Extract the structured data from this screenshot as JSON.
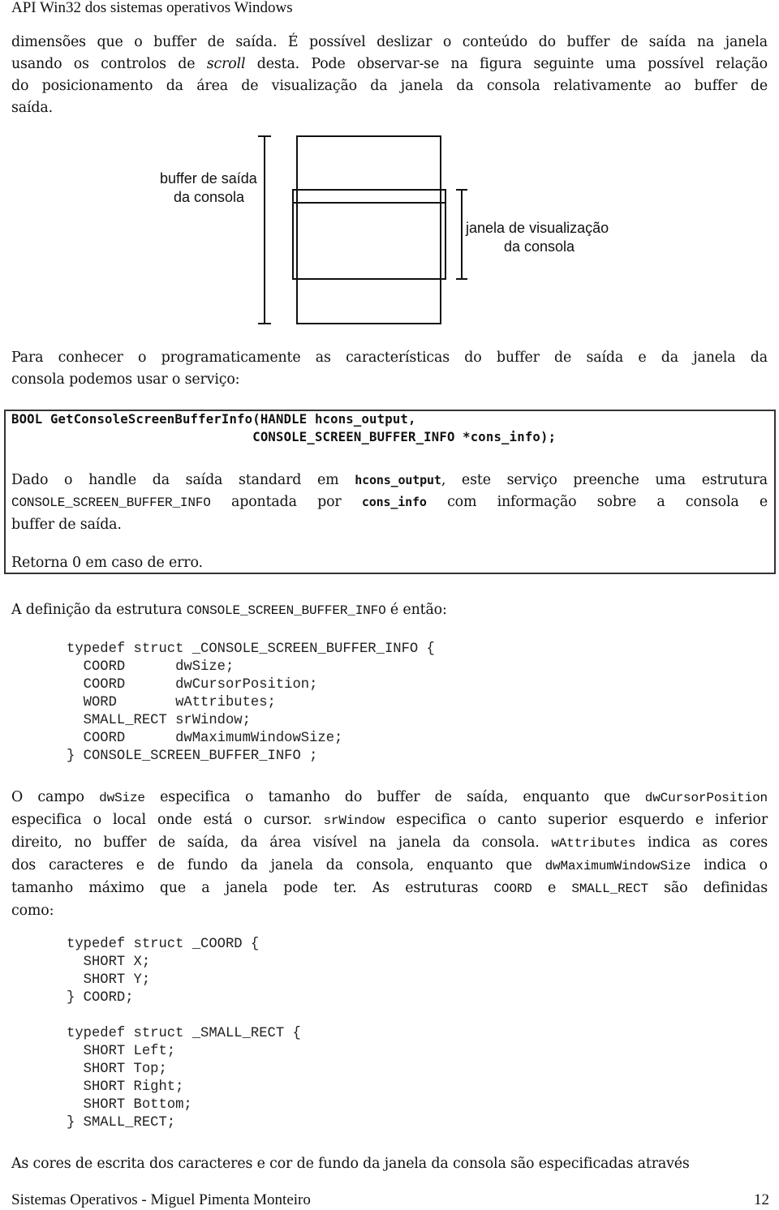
{
  "header": {
    "title": "API Win32 dos sistemas operativos Windows"
  },
  "intro": {
    "lines": [
      [
        {
          "t": "dimensões que o buffer de saída.  É possível deslizar o conteúdo do buffer de saída na janela"
        }
      ],
      [
        {
          "t": "usando os controlos de "
        },
        {
          "t": "scroll",
          "i": true
        },
        {
          "t": " desta.  Pode observar-se na figura seguinte uma possível relação"
        }
      ],
      [
        {
          "t": "do posicionamento da área de visualização da janela da consola relativamente ao buffer de"
        }
      ],
      [
        {
          "t": "saída."
        }
      ]
    ]
  },
  "figure": {
    "buffer_label_line1": "buffer de saída",
    "buffer_label_line2": "da consola",
    "window_label_line1": "janela de visualização",
    "window_label_line2": "da consola"
  },
  "para_service": {
    "lines": [
      [
        {
          "t": "Para conhecer o programaticamente as características do buffer de saída e da janela da"
        }
      ],
      [
        {
          "t": "consola podemos usar o serviço:"
        }
      ]
    ]
  },
  "service_box": {
    "signature_line1": "BOOL GetConsoleScreenBufferInfo(HANDLE hcons_output,",
    "signature_line2": "                               CONSOLE_SCREEN_BUFFER_INFO *cons_info);",
    "desc_lines": [
      [
        {
          "t": "Dado o handle da saída standard em "
        },
        {
          "t": "hcons_output",
          "mb": true
        },
        {
          "t": ", este serviço preenche uma estrutura"
        }
      ],
      [
        {
          "t": "CONSOLE_SCREEN_BUFFER_INFO",
          "m": true
        },
        {
          "t": " apontada por "
        },
        {
          "t": "cons_info",
          "mb": true
        },
        {
          "t": " com informação sobre a consola e"
        }
      ],
      [
        {
          "t": "buffer de saída."
        }
      ]
    ],
    "return_text": "Retorna 0 em caso de erro."
  },
  "struct_intro": {
    "lines": [
      [
        {
          "t": "A definição da estrutura "
        },
        {
          "t": "CONSOLE_SCREEN_BUFFER_INFO",
          "m": true
        },
        {
          "t": " é então:"
        }
      ]
    ]
  },
  "struct_console_info": [
    "typedef struct _CONSOLE_SCREEN_BUFFER_INFO {",
    "  COORD      dwSize;",
    "  COORD      dwCursorPosition;",
    "  WORD       wAttributes;",
    "  SMALL_RECT srWindow;",
    "  COORD      dwMaximumWindowSize;",
    "} CONSOLE_SCREEN_BUFFER_INFO ;"
  ],
  "fields_para": {
    "lines": [
      [
        {
          "t": "O campo "
        },
        {
          "t": "dwSize",
          "m": true
        },
        {
          "t": " especifica o tamanho do buffer de saída, enquanto que "
        },
        {
          "t": "dwCursorPosition",
          "m": true
        }
      ],
      [
        {
          "t": "especifica o local onde está o cursor.  "
        },
        {
          "t": "srWindow",
          "m": true
        },
        {
          "t": " especifica o canto superior esquerdo e inferior"
        }
      ],
      [
        {
          "t": "direito, no buffer de saída, da área visível na janela da consola.  "
        },
        {
          "t": "wAttributes",
          "m": true
        },
        {
          "t": " indica as cores"
        }
      ],
      [
        {
          "t": "dos caracteres e de fundo da janela da consola, enquanto que "
        },
        {
          "t": "dwMaximumWindowSize",
          "m": true
        },
        {
          "t": " indica o"
        }
      ],
      [
        {
          "t": "tamanho máximo que a janela pode ter.  As estruturas "
        },
        {
          "t": "COORD",
          "m": true
        },
        {
          "t": " e "
        },
        {
          "t": "SMALL_RECT",
          "m": true
        },
        {
          "t": " são definidas"
        }
      ],
      [
        {
          "t": "como:"
        }
      ]
    ]
  },
  "struct_coord": [
    "typedef struct _COORD {",
    "  SHORT X;",
    "  SHORT Y;",
    "} COORD;"
  ],
  "struct_small_rect": [
    "typedef struct _SMALL_RECT {",
    "  SHORT Left;",
    "  SHORT Top;",
    "  SHORT Right;",
    "  SHORT Bottom;",
    "} SMALL_RECT;"
  ],
  "closing_para": {
    "lines": [
      [
        {
          "t": "As cores de escrita dos caracteres e cor de fundo da janela da consola são especificadas através"
        }
      ]
    ]
  },
  "footer": {
    "left": "Sistemas Operativos - Miguel Pimenta Monteiro",
    "page_number": "12"
  }
}
